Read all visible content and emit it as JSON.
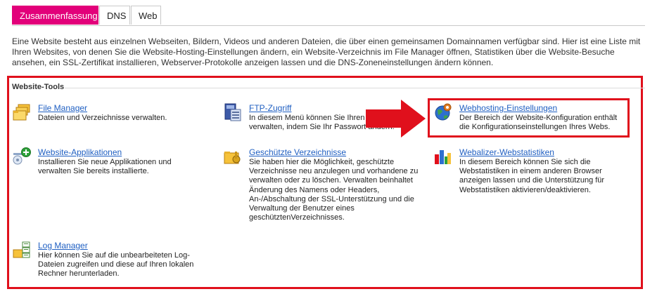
{
  "tabs": [
    {
      "label": "Zusammenfassung",
      "active": true
    },
    {
      "label": "DNS",
      "active": false
    },
    {
      "label": "Web",
      "active": false
    }
  ],
  "intro_text": "Eine Website besteht aus einzelnen Webseiten, Bildern, Videos und anderen Dateien, die über einen gemeinsamen Domainnamen verfügbar sind. Hier ist eine Liste mit Ihren Websites, von denen Sie die Website-Hosting-Einstellungen ändern, ein Website-Verzeichnis im File Manager öffnen, Statistiken über die Website-Besuche ansehen, ein SSL-Zertifikat installieren, Webserver-Protokolle anzeigen lassen und die DNS-Zoneneinstellungen ändern können.",
  "section_title": "Website-Tools",
  "tools": {
    "file_manager": {
      "title": "File Manager",
      "desc": "Dateien und Verzeichnisse verwalten.",
      "icon": "folders-icon"
    },
    "ftp": {
      "title": "FTP-Zugriff",
      "desc": "In diesem Menü können Sie Ihren FTP-Zugriff verwalten, indem Sie Ihr Passwort ändern.",
      "icon": "ftp-server-icon"
    },
    "webhosting": {
      "title": "Webhosting-Einstellungen",
      "desc": "Der Bereich der Website-Konfiguration enthält die Konfigurationseinstellungen Ihres Webs.",
      "icon": "globe-gear-icon"
    },
    "apps": {
      "title": "Website-Applikationen",
      "desc": "Installieren Sie neue Applikationen und verwalten Sie bereits installierte.",
      "icon": "add-application-icon"
    },
    "protected_dirs": {
      "title": "Geschützte Verzeichnisse",
      "desc": "Sie haben hier die Möglichkeit, geschützte Verzeichnisse neu anzulegen und vorhandene zu verwalten oder zu löschen. Verwalten beinhaltet Änderung des Namens oder Headers, An-/Abschaltung der SSL-Unterstützung und die Verwaltung der Benutzer eines geschütztenVerzeichnisses.",
      "icon": "locked-folder-icon"
    },
    "webalizer": {
      "title": "Webalizer-Webstatistiken",
      "desc": "In diesem Bereich können Sie sich die Webstatistiken in einem anderen Browser anzeigen lassen und die Unterstützung für Webstatistiken aktivieren/deaktivieren.",
      "icon": "bar-chart-icon"
    },
    "log_manager": {
      "title": "Log Manager",
      "desc": "Hier können Sie auf die unbearbeiteten Log-Dateien zugreifen und diese auf Ihren lokalen Rechner herunterladen.",
      "icon": "log-files-icon"
    }
  },
  "colors": {
    "accent": "#e2007a",
    "highlight": "#e0101c",
    "link": "#1f5fc2"
  }
}
